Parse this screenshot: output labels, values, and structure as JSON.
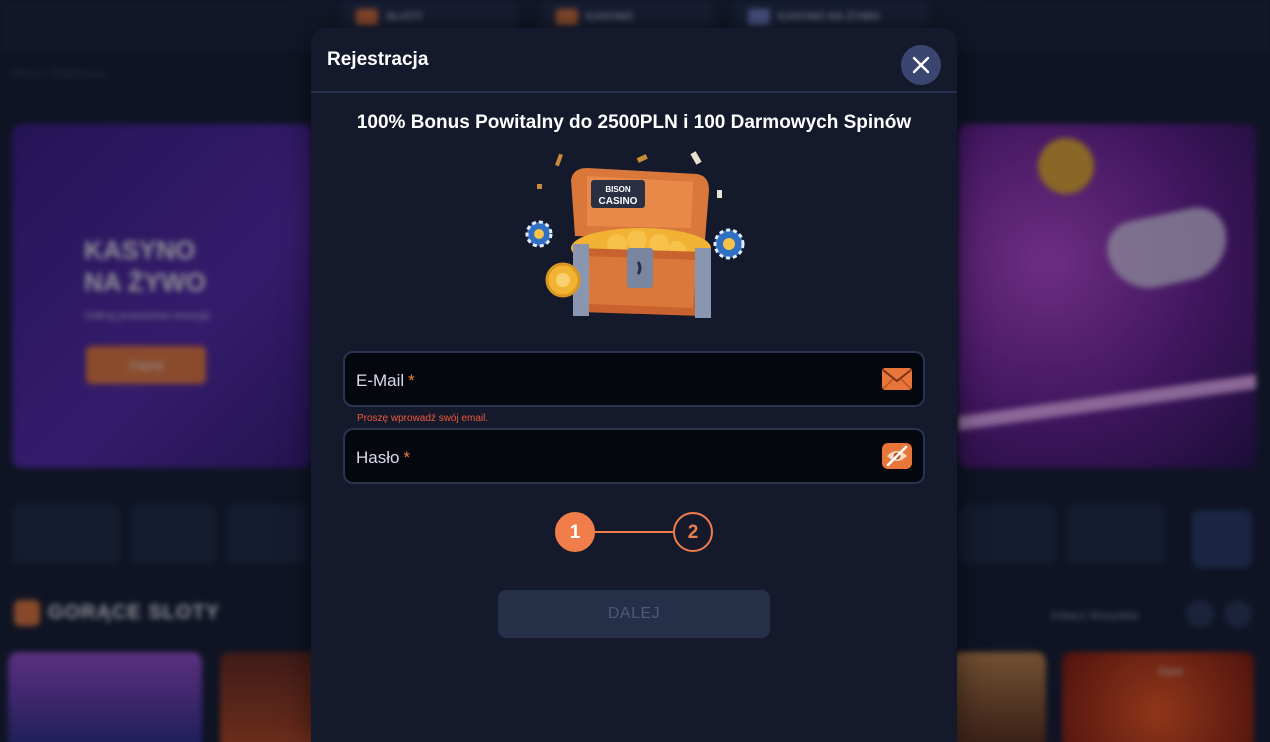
{
  "background": {
    "nav": [
      "SLOTY",
      "KASYNO",
      "KASYNO NA ŻYWO"
    ],
    "breadcrumb": "Home / Rejestracja",
    "hero": {
      "title_line1": "KASYNO",
      "title_line2": "NA ŻYWO",
      "subtitle": "Odkryj prawdziwe emocje.",
      "button": "Zagraj"
    },
    "section_title": "GORĄCE SLOTY",
    "see_all": "Zobacz Wszystkie",
    "save_label": "Save"
  },
  "modal": {
    "title": "Rejestracja",
    "bonus_text": "100% Bonus Powitalny do 2500PLN i 100 Darmowych Spinów",
    "chest_brand_top": "BISON",
    "chest_brand_bottom": "CASINO",
    "email": {
      "label": "E-Mail",
      "required_mark": "*",
      "error": "Proszę wprowadź swój email.",
      "icon": "envelope-icon"
    },
    "password": {
      "label": "Hasło",
      "required_mark": "*",
      "icon": "eye-slash-icon"
    },
    "steps": [
      "1",
      "2"
    ],
    "active_step": 1,
    "next_button": "DALEJ"
  },
  "colors": {
    "accent": "#f07d4a",
    "modal_bg": "#141a2c",
    "error": "#f0563a"
  }
}
